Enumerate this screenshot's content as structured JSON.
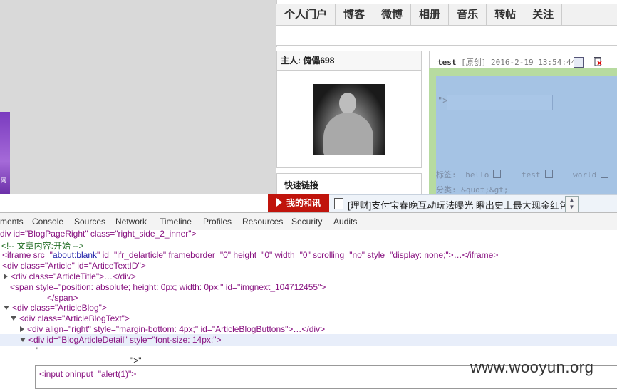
{
  "blog_nav": [
    "个人门户",
    "博客",
    "微博",
    "相册",
    "音乐",
    "转帖",
    "关注"
  ],
  "owner": {
    "label": "主人:",
    "name": "傀儡698"
  },
  "quicklinks": {
    "title": "快速链接"
  },
  "left_strip_text": "网",
  "article": {
    "title": "test",
    "meta": "[原创] 2016-2-19 13:54:44]",
    "quot": "\">",
    "tags_label": "标签:",
    "tags": [
      "hello",
      "test",
      "world"
    ],
    "category": "分类: &quot;&gt;"
  },
  "ticker": {
    "badge": "我的和讯",
    "text": "[理财]支付宝春晚互动玩法曝光 瞅出史上最大现金红包"
  },
  "devtools": {
    "tabs": [
      "ments",
      "Console",
      "Sources",
      "Network",
      "Timeline",
      "Profiles",
      "Resources",
      "Security",
      "Audits"
    ],
    "lines": {
      "l0": "div id=\"BlogPageRight\" class=\"right_side_2_inner\">",
      "l1": "<!--  文章内容:开始  -->",
      "l2a": "<iframe src=\"",
      "l2b": "about:blank",
      "l2c": "\" id=\"ifr_delarticle\" frameborder=\"0\" height=\"0\" width=\"0\" scrolling=\"no\" style=\"display: none;\">…</iframe>",
      "l3": "<div class=\"Article\" id=\"ArticeTextID\">",
      "l4": "<div class=\"ArticleTitle\">…</div>",
      "l5": "<span style=\"position: absolute; height: 0px; width: 0px;\" id=\"imgnext_104712455\">",
      "l6": "</span>",
      "l7": "<div class=\"ArticleBlog\">",
      "l8": "<div class=\"ArticleBlogText\">",
      "l9": "<div align=\"right\" style=\"margin-bottom: 4px;\" id=\"ArticleBlogButtons\">…</div>",
      "l10": "<div id=\"BlogArticleDetail\" style=\"font-size: 14px;\">",
      "l11": "\"",
      "l12": "\">\"",
      "edit": "<input oninput=\"alert(1)\">"
    }
  },
  "watermark": "www.wooyun.org"
}
